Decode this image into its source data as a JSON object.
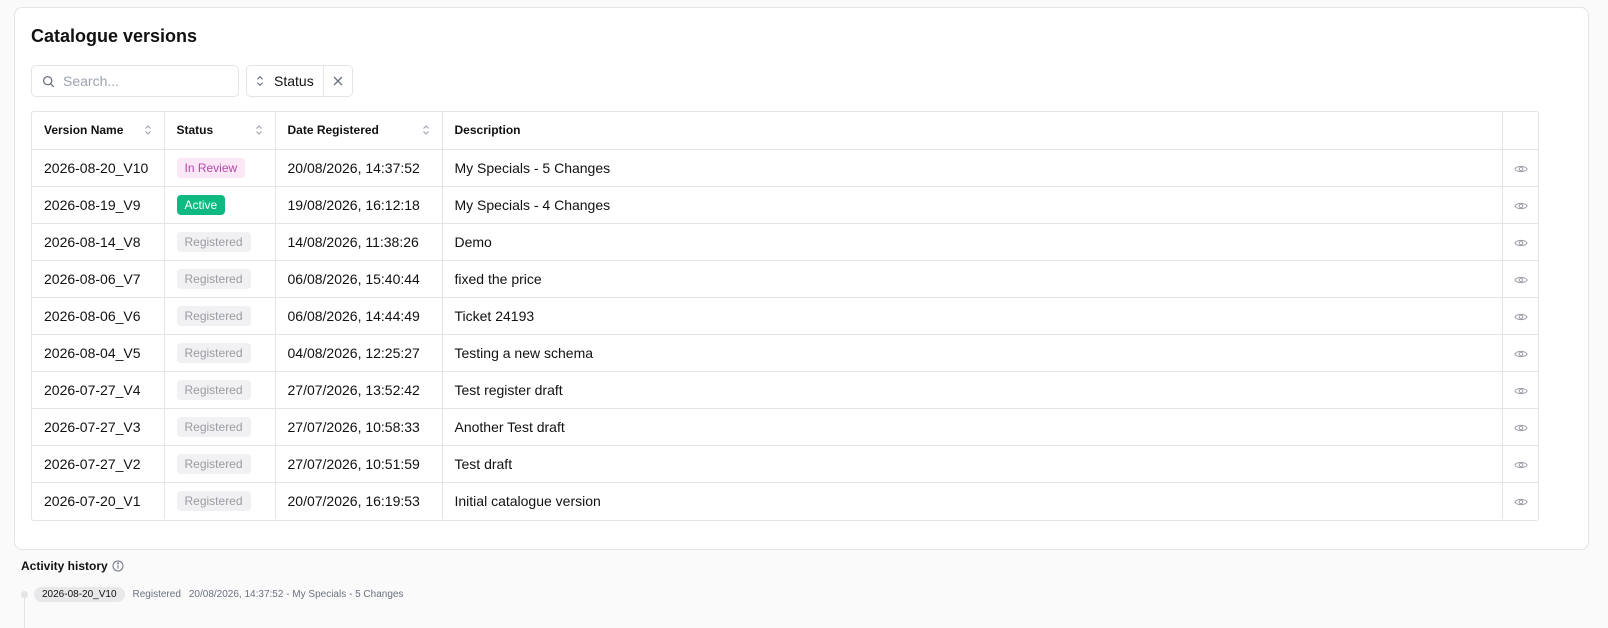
{
  "card": {
    "title": "Catalogue versions"
  },
  "search": {
    "placeholder": "Search...",
    "value": ""
  },
  "filter": {
    "label": "Status"
  },
  "table": {
    "columns": [
      "Version Name",
      "Status",
      "Date Registered",
      "Description"
    ],
    "rows": [
      {
        "version": "2026-08-20_V10",
        "status": "In Review",
        "status_kind": "review",
        "date": "20/08/2026, 14:37:52",
        "description": "My Specials - 5 Changes"
      },
      {
        "version": "2026-08-19_V9",
        "status": "Active",
        "status_kind": "active",
        "date": "19/08/2026, 16:12:18",
        "description": "My Specials - 4 Changes"
      },
      {
        "version": "2026-08-14_V8",
        "status": "Registered",
        "status_kind": "registered",
        "date": "14/08/2026, 11:38:26",
        "description": "Demo"
      },
      {
        "version": "2026-08-06_V7",
        "status": "Registered",
        "status_kind": "registered",
        "date": "06/08/2026, 15:40:44",
        "description": "fixed the price"
      },
      {
        "version": "2026-08-06_V6",
        "status": "Registered",
        "status_kind": "registered",
        "date": "06/08/2026, 14:44:49",
        "description": "Ticket 24193"
      },
      {
        "version": "2026-08-04_V5",
        "status": "Registered",
        "status_kind": "registered",
        "date": "04/08/2026, 12:25:27",
        "description": "Testing a new schema"
      },
      {
        "version": "2026-07-27_V4",
        "status": "Registered",
        "status_kind": "registered",
        "date": "27/07/2026, 13:52:42",
        "description": "Test register draft"
      },
      {
        "version": "2026-07-27_V3",
        "status": "Registered",
        "status_kind": "registered",
        "date": "27/07/2026, 10:58:33",
        "description": "Another Test draft"
      },
      {
        "version": "2026-07-27_V2",
        "status": "Registered",
        "status_kind": "registered",
        "date": "27/07/2026, 10:51:59",
        "description": "Test draft"
      },
      {
        "version": "2026-07-20_V1",
        "status": "Registered",
        "status_kind": "registered",
        "date": "20/07/2026, 16:19:53",
        "description": "Initial catalogue version"
      }
    ]
  },
  "activity": {
    "title": "Activity history",
    "items": [
      {
        "version": "2026-08-20_V10",
        "status": "Registered",
        "detail": "20/08/2026, 14:37:52 - My Specials - 5 Changes"
      }
    ]
  },
  "icons": {
    "search": "search-icon",
    "sort": "sort-icon",
    "clear": "close-icon",
    "view": "eye-icon",
    "info": "info-icon"
  },
  "colors": {
    "active": "#10b981",
    "review_bg": "#fce7f6",
    "review_text": "#b648a8",
    "registered_bg": "#f1f1f3",
    "registered_text": "#9a9ca3"
  }
}
